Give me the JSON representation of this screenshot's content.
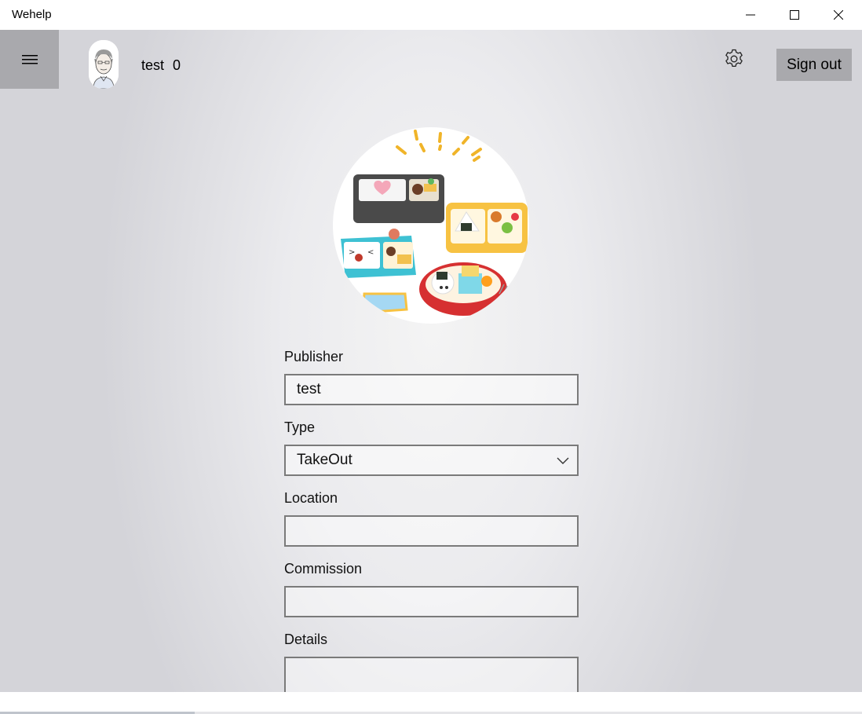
{
  "window": {
    "title": "Wehelp"
  },
  "header": {
    "user_name": "test",
    "user_count": "0",
    "signout_label": "Sign out"
  },
  "form": {
    "publisher": {
      "label": "Publisher",
      "value": "test"
    },
    "type": {
      "label": "Type",
      "value": "TakeOut"
    },
    "location": {
      "label": "Location",
      "value": ""
    },
    "commission": {
      "label": "Commission",
      "value": ""
    },
    "details": {
      "label": "Details",
      "value": ""
    }
  },
  "icons": [
    "minimize-icon",
    "maximize-icon",
    "close-icon",
    "hamburger-icon",
    "gear-icon",
    "chevron-down-icon"
  ],
  "colors": {
    "nav_button": "#a9a9ad",
    "field_border": "#7a7a7a",
    "background_center": "#f4f4f4",
    "background_edge": "#d4d4d9"
  }
}
